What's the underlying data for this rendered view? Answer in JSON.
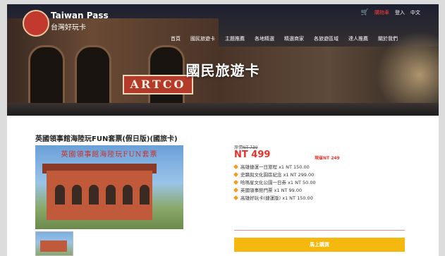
{
  "header": {
    "logo_en": "Taiwan Pass",
    "logo_zh": "台灣好玩卡",
    "cart_label": "購物車",
    "login_label": "登入",
    "lang_label": "中文"
  },
  "nav": [
    "首頁",
    "國民旅遊卡",
    "主題推薦",
    "各地精選",
    "精選商家",
    "各旅遊區域",
    "達人推薦",
    "關於我們"
  ],
  "hero": {
    "title": "國民旅遊卡",
    "sign_text": "ARTCO"
  },
  "product": {
    "title": "英國領事館海陸玩FUN套票(假日版)(國旅卡)",
    "image_caption": "英國領事館海陸玩FUN套票",
    "original_price_label": "原價",
    "original_price_value": "NT 730",
    "price": "NT 499",
    "save": "現省NT 249",
    "items": [
      "高雄捷運一日旅程 x1 NT 150.00",
      "史蹟與文化園區紀念 x1 NT 299.00",
      "哈瑪星文化公園一日券 x1 NT 50.00",
      "英國領事館門票 x1 NT 99.00",
      "高雄好玩卡(捷運版) x1 NT 150.00"
    ],
    "buy_label": "馬上購買"
  },
  "colors": {
    "accent": "#e8312a",
    "buy_button": "#f5b80f",
    "bullet": "#f0a020"
  },
  "icons": [
    "cart-icon",
    "bullet-icon"
  ]
}
